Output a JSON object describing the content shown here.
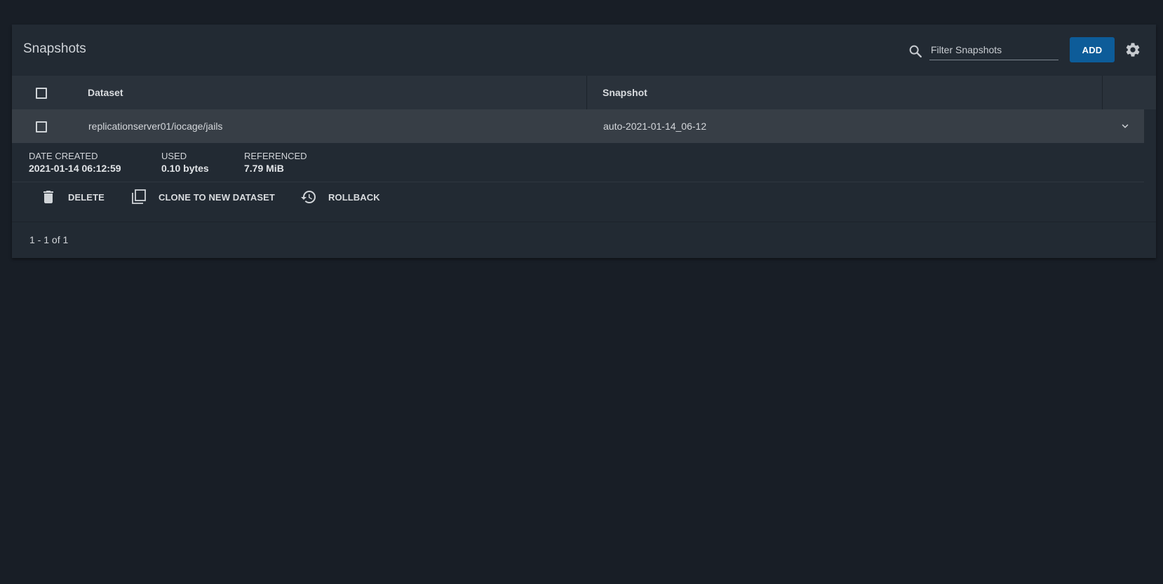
{
  "header": {
    "title": "Snapshots",
    "filter_placeholder": "Filter Snapshots",
    "add_label": "ADD"
  },
  "table": {
    "columns": [
      "Dataset",
      "Snapshot"
    ],
    "rows": [
      {
        "dataset": "replicationserver01/iocage/jails",
        "snapshot": "auto-2021-01-14_06-12"
      }
    ]
  },
  "details": {
    "date_created_label": "DATE CREATED",
    "date_created_value": "2021-01-14 06:12:59",
    "used_label": "USED",
    "used_value": "0.10 bytes",
    "referenced_label": "REFERENCED",
    "referenced_value": "7.79 MiB"
  },
  "actions": {
    "delete_label": "DELETE",
    "clone_label": "CLONE TO NEW DATASET",
    "rollback_label": "ROLLBACK"
  },
  "footer": {
    "pagination": "1 - 1 of 1"
  },
  "icons": {
    "search": "search-icon",
    "settings": "gear-icon",
    "expand": "chevron-down-icon",
    "delete": "trash-icon",
    "clone": "copy-icon",
    "rollback": "history-icon"
  },
  "colors": {
    "background": "#181e26",
    "card": "#222a33",
    "table_header": "#2a323b",
    "row": "#373e46",
    "accent": "#0d5c99"
  }
}
